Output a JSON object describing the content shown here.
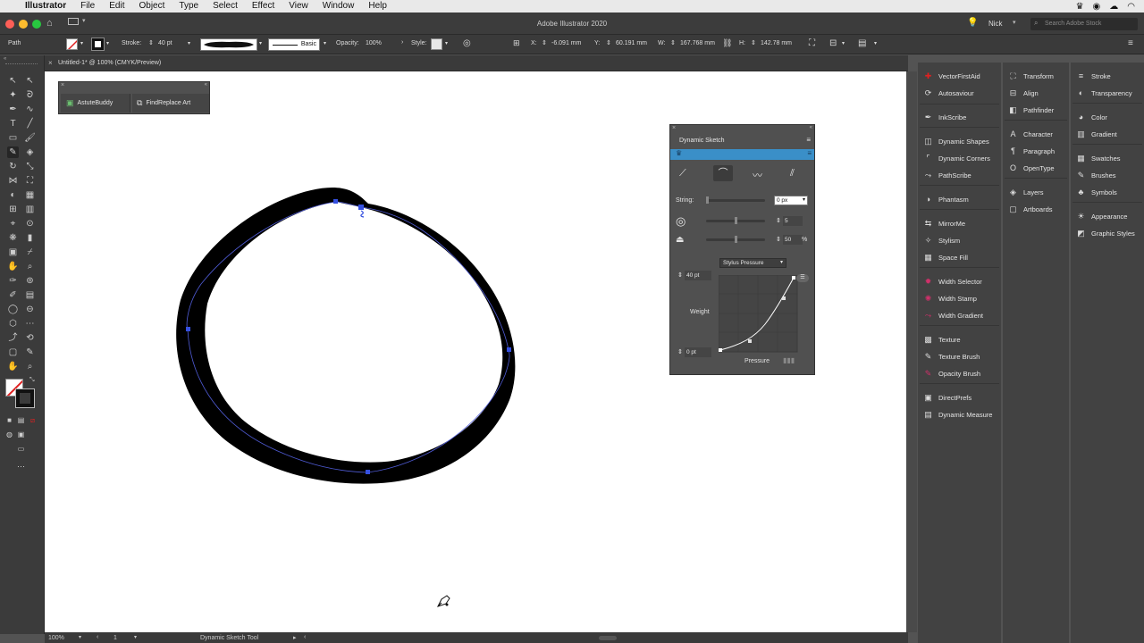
{
  "menubar": {
    "app": "Illustrator",
    "items": [
      "File",
      "Edit",
      "Object",
      "Type",
      "Select",
      "Effect",
      "View",
      "Window",
      "Help"
    ]
  },
  "titlebar": {
    "title": "Adobe Illustrator 2020",
    "user": "Nick",
    "search_placeholder": "Search Adobe Stock"
  },
  "control": {
    "selection": "Path",
    "stroke_label": "Stroke:",
    "stroke_value": "40 pt",
    "brush_label": "Basic",
    "opacity_label": "Opacity:",
    "opacity_value": "100%",
    "style_label": "Style:",
    "x_label": "X:",
    "x_value": "-6.091 mm",
    "y_label": "Y:",
    "y_value": "60.191 mm",
    "w_label": "W:",
    "w_value": "167.768 mm",
    "h_label": "H:",
    "h_value": "142.78 mm"
  },
  "document": {
    "tab_title": "Untitled-1* @ 100% (CMYK/Preview)"
  },
  "status": {
    "zoom": "100%",
    "artboard": "1",
    "tool": "Dynamic Sketch Tool"
  },
  "float_panel": {
    "astutebuddy": "AstuteBuddy",
    "findreplace": "FindReplace Art"
  },
  "dynamic_sketch": {
    "title": "Dynamic Sketch",
    "string_label": "String:",
    "string_value": "0 px",
    "smooth_value": "5",
    "fidelity_value": "50",
    "fidelity_unit": "%",
    "pressure_mode": "Stylus Pressure",
    "max_weight": "40 pt",
    "weight_label": "Weight",
    "min_weight": "0 pt",
    "pressure_label": "Pressure"
  },
  "plugins_col": [
    {
      "label": "VectorFirstAid",
      "icon": "plus-icon"
    },
    {
      "label": "Autosaviour",
      "icon": "autosave-icon"
    },
    {
      "label": "InkScribe",
      "icon": "pen-icon"
    },
    {
      "label": "Dynamic Shapes",
      "icon": "shapes-icon"
    },
    {
      "label": "Dynamic Corners",
      "icon": "corners-icon"
    },
    {
      "label": "PathScribe",
      "icon": "pathscribe-icon"
    },
    {
      "label": "Phantasm",
      "icon": "phantasm-icon"
    },
    {
      "label": "MirrorMe",
      "icon": "mirror-icon"
    },
    {
      "label": "Stylism",
      "icon": "stylism-icon"
    },
    {
      "label": "Space Fill",
      "icon": "spacefill-icon"
    },
    {
      "label": "Width Selector",
      "icon": "width-selector-icon"
    },
    {
      "label": "Width Stamp",
      "icon": "width-stamp-icon"
    },
    {
      "label": "Width Gradient",
      "icon": "width-gradient-icon"
    },
    {
      "label": "Texture",
      "icon": "texture-icon"
    },
    {
      "label": "Texture Brush",
      "icon": "texture-brush-icon"
    },
    {
      "label": "Opacity Brush",
      "icon": "opacity-brush-icon"
    },
    {
      "label": "DirectPrefs",
      "icon": "prefs-icon"
    },
    {
      "label": "Dynamic Measure",
      "icon": "measure-icon"
    }
  ],
  "panels_col2": [
    {
      "label": "Transform",
      "icon": "transform-icon"
    },
    {
      "label": "Align",
      "icon": "align-icon"
    },
    {
      "label": "Pathfinder",
      "icon": "pathfinder-icon"
    },
    {
      "label": "Character",
      "icon": "character-icon"
    },
    {
      "label": "Paragraph",
      "icon": "paragraph-icon"
    },
    {
      "label": "OpenType",
      "icon": "opentype-icon"
    },
    {
      "label": "Layers",
      "icon": "layers-icon"
    },
    {
      "label": "Artboards",
      "icon": "artboards-icon"
    }
  ],
  "panels_col3": [
    {
      "label": "Stroke",
      "icon": "stroke-icon"
    },
    {
      "label": "Transparency",
      "icon": "transparency-icon"
    },
    {
      "label": "Color",
      "icon": "color-icon"
    },
    {
      "label": "Gradient",
      "icon": "gradient-icon"
    },
    {
      "label": "Swatches",
      "icon": "swatches-icon"
    },
    {
      "label": "Brushes",
      "icon": "brushes-icon"
    },
    {
      "label": "Symbols",
      "icon": "symbols-icon"
    },
    {
      "label": "Appearance",
      "icon": "appearance-icon"
    },
    {
      "label": "Graphic Styles",
      "icon": "graphic-styles-icon"
    }
  ]
}
